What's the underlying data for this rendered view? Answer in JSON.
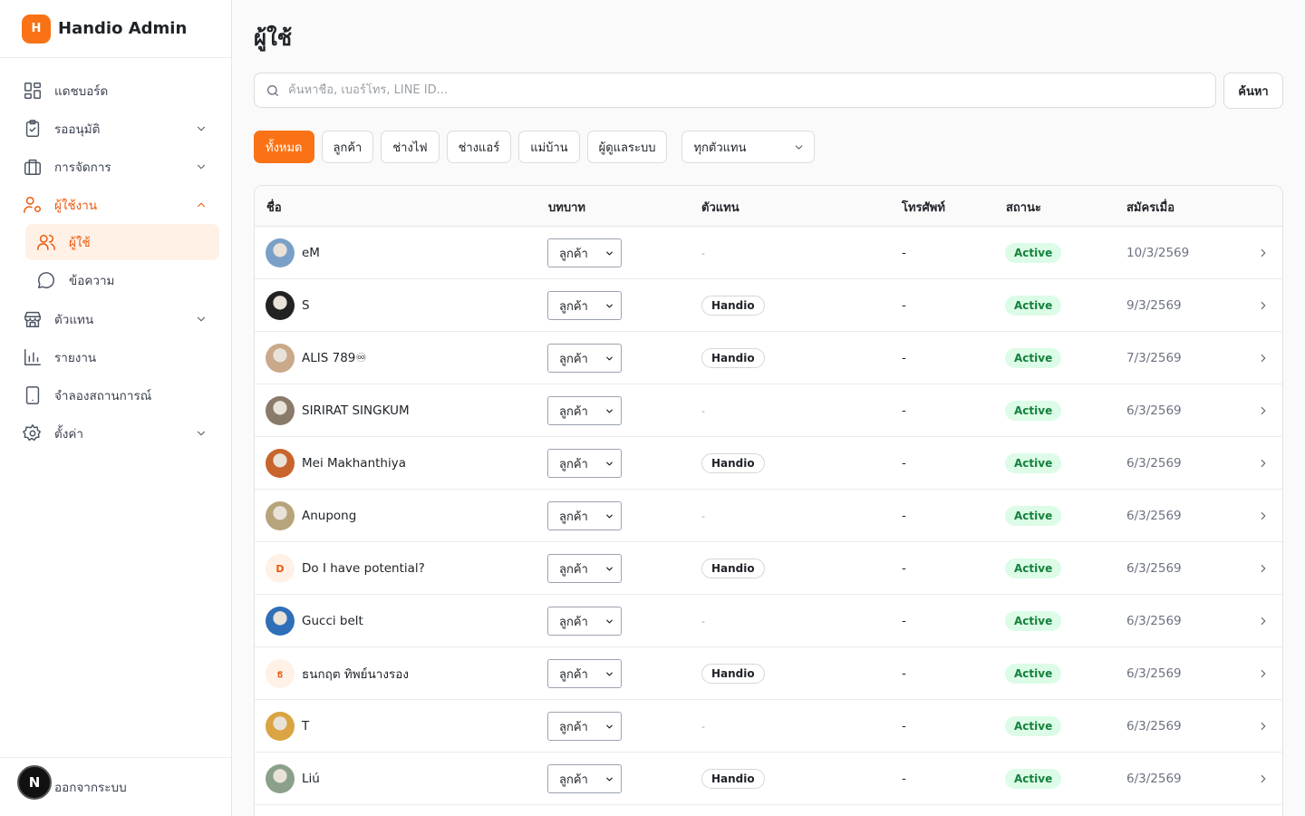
{
  "brand": {
    "logo_letter": "H",
    "name": "Handio Admin",
    "accent": "#f97316"
  },
  "nav": {
    "dashboard": "แดชบอร์ด",
    "approvals": "รออนุมัติ",
    "management": "การจัดการ",
    "users_group": "ผู้ใช้งาน",
    "users": "ผู้ใช้",
    "messages": "ข้อความ",
    "agents": "ตัวแทน",
    "reports": "รายงาน",
    "simulation": "จำลองสถานการณ์",
    "settings": "ตั้งค่า",
    "logout": "ออกจากระบบ",
    "user_badge": "N"
  },
  "page": {
    "title": "ผู้ใช้"
  },
  "search": {
    "placeholder": "ค้นหาชื่อ, เบอร์โทร, LINE ID...",
    "value": "",
    "button": "ค้นหา"
  },
  "filters": {
    "chips": [
      "ทั้งหมด",
      "ลูกค้า",
      "ช่างไฟ",
      "ช่างแอร์",
      "แม่บ้าน",
      "ผู้ดูแลระบบ"
    ],
    "active_index": 0,
    "agent_select": "ทุกตัวแทน"
  },
  "table": {
    "headers": {
      "name": "ชื่อ",
      "role": "บทบาท",
      "agent": "ตัวแทน",
      "phone": "โทรศัพท์",
      "status": "สถานะ",
      "joined": "สมัครเมื่อ"
    },
    "rows": [
      {
        "name": "eM",
        "avatar": "photo",
        "avatar_color": "#7aa0c8",
        "role": "ลูกค้า",
        "agent": "-",
        "phone": "-",
        "status": "Active",
        "joined": "10/3/2569"
      },
      {
        "name": "S",
        "avatar": "photo",
        "avatar_color": "#222222",
        "role": "ลูกค้า",
        "agent": "Handio",
        "phone": "-",
        "status": "Active",
        "joined": "9/3/2569"
      },
      {
        "name": "ALIS 789♾",
        "avatar": "photo",
        "avatar_color": "#c9a98a",
        "role": "ลูกค้า",
        "agent": "Handio",
        "phone": "-",
        "status": "Active",
        "joined": "7/3/2569"
      },
      {
        "name": "SIRIRAT SINGKUM",
        "avatar": "photo",
        "avatar_color": "#8a7a6a",
        "role": "ลูกค้า",
        "agent": "-",
        "phone": "-",
        "status": "Active",
        "joined": "6/3/2569"
      },
      {
        "name": "Mei Makhanthiya",
        "avatar": "photo",
        "avatar_color": "#c8642e",
        "role": "ลูกค้า",
        "agent": "Handio",
        "phone": "-",
        "status": "Active",
        "joined": "6/3/2569"
      },
      {
        "name": "Anupong",
        "avatar": "photo",
        "avatar_color": "#b8a47a",
        "role": "ลูกค้า",
        "agent": "-",
        "phone": "-",
        "status": "Active",
        "joined": "6/3/2569"
      },
      {
        "name": "Do I have potential?",
        "avatar": "initial",
        "initial": "D",
        "role": "ลูกค้า",
        "agent": "Handio",
        "phone": "-",
        "status": "Active",
        "joined": "6/3/2569"
      },
      {
        "name": "Gucci belt",
        "avatar": "photo",
        "avatar_color": "#2f6fb8",
        "role": "ลูกค้า",
        "agent": "-",
        "phone": "-",
        "status": "Active",
        "joined": "6/3/2569"
      },
      {
        "name": "ธนกฤต ทิพย์นางรอง",
        "avatar": "initial",
        "initial": "ธ",
        "role": "ลูกค้า",
        "agent": "Handio",
        "phone": "-",
        "status": "Active",
        "joined": "6/3/2569"
      },
      {
        "name": "T",
        "avatar": "photo",
        "avatar_color": "#d9a441",
        "role": "ลูกค้า",
        "agent": "-",
        "phone": "-",
        "status": "Active",
        "joined": "6/3/2569"
      },
      {
        "name": "Liú",
        "avatar": "photo",
        "avatar_color": "#8aa08a",
        "role": "ลูกค้า",
        "agent": "Handio",
        "phone": "-",
        "status": "Active",
        "joined": "6/3/2569"
      }
    ]
  }
}
